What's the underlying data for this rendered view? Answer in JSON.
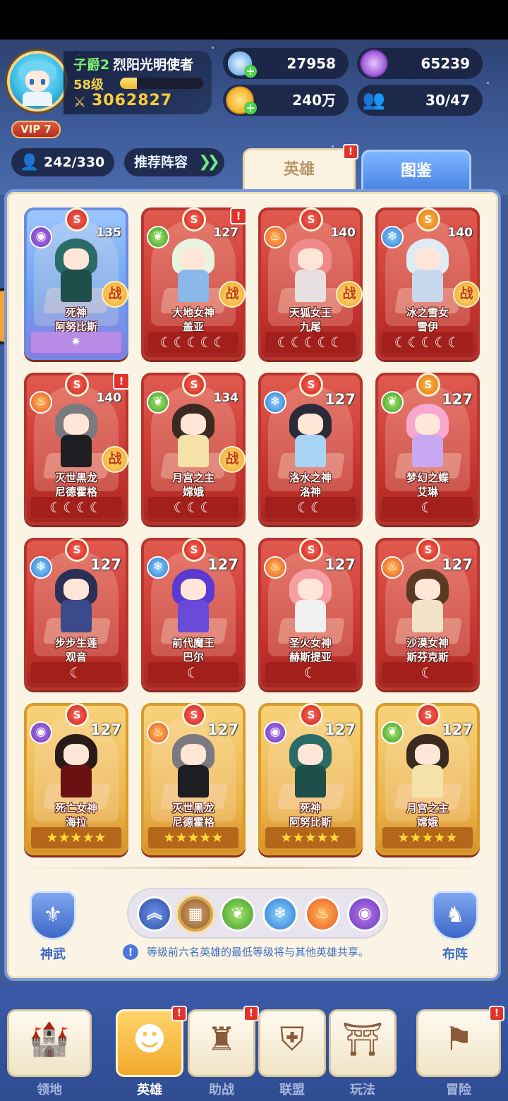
{
  "player": {
    "rank": "子爵2",
    "title": "烈阳光明使者",
    "level": "58级",
    "exp_progress": 0.2,
    "power": "3062827",
    "vip": "VIP 7"
  },
  "resources": {
    "crystals": "27958",
    "orbs": "65239",
    "gold": "240万",
    "friends": "30/47"
  },
  "hero_slots": "242/330",
  "recommend_label": "推荐阵容",
  "tabs": {
    "heroes": "英雄",
    "codex": "图鉴"
  },
  "battle_mark": "战",
  "heroes": [
    {
      "grade": "S",
      "element": "dark",
      "level": "135",
      "title": "死神",
      "name": "阿努比斯",
      "bottom": "✷",
      "style": "blue",
      "battle": true
    },
    {
      "grade": "S",
      "element": "nature",
      "level": "127",
      "title": "大地女神",
      "name": "盖亚",
      "bottom": "☾☾☾☾☾",
      "style": "red",
      "battle": true,
      "alert": true
    },
    {
      "grade": "S",
      "element": "fire",
      "level": "140",
      "title": "天狐女王",
      "name": "九尾",
      "bottom": "☾☾☾☾☾",
      "style": "red",
      "battle": true
    },
    {
      "grade": "S",
      "element": "ice",
      "level": "140",
      "title": "冰之雪女",
      "name": "雪伊",
      "bottom": "☾☾☾☾☾",
      "style": "red",
      "battle": true,
      "gold_grade": true
    },
    {
      "grade": "S",
      "element": "fire",
      "level": "140",
      "title": "灭世黑龙",
      "name": "尼德霍格",
      "bottom": "☾☾☾☾",
      "style": "red",
      "battle": true,
      "alert": true
    },
    {
      "grade": "S",
      "element": "nature",
      "level": "134",
      "title": "月宫之主",
      "name": "嫦娥",
      "bottom": "☾☾☾",
      "style": "red",
      "battle": true
    },
    {
      "grade": "S",
      "element": "ice",
      "level": "127",
      "title": "洛水之神",
      "name": "洛神",
      "bottom": "☾☾",
      "style": "red"
    },
    {
      "grade": "S",
      "element": "nature",
      "level": "127",
      "title": "梦幻之蝶",
      "name": "艾琳",
      "bottom": "☾",
      "style": "red",
      "gold_grade": true
    },
    {
      "grade": "S",
      "element": "ice",
      "level": "127",
      "title": "步步生莲",
      "name": "观音",
      "bottom": "☾",
      "style": "red"
    },
    {
      "grade": "S",
      "element": "ice",
      "level": "127",
      "title": "前代魔王",
      "name": "巴尔",
      "bottom": "☾",
      "style": "red"
    },
    {
      "grade": "S",
      "element": "fire",
      "level": "127",
      "title": "圣火女神",
      "name": "赫斯提亚",
      "bottom": "☾",
      "style": "red"
    },
    {
      "grade": "S",
      "element": "fire",
      "level": "127",
      "title": "沙漠女神",
      "name": "斯芬克斯",
      "bottom": "☾",
      "style": "red"
    },
    {
      "grade": "S",
      "element": "dark",
      "level": "127",
      "title": "死亡女神",
      "name": "海拉",
      "bottom": "★★★★★",
      "style": "gold"
    },
    {
      "grade": "S",
      "element": "fire",
      "level": "127",
      "title": "灭世黑龙",
      "name": "尼德霍格",
      "bottom": "★★★★★",
      "style": "gold"
    },
    {
      "grade": "S",
      "element": "dark",
      "level": "127",
      "title": "死神",
      "name": "阿努比斯",
      "bottom": "★★★★★",
      "style": "gold"
    },
    {
      "grade": "S",
      "element": "nature",
      "level": "127",
      "title": "月宫之主",
      "name": "嫦娥",
      "bottom": "★★★★★",
      "style": "gold"
    }
  ],
  "side_buttons": {
    "left": "神武",
    "right": "布阵"
  },
  "filters": [
    "rank",
    "all",
    "nature",
    "ice",
    "fire",
    "dark"
  ],
  "hint": "等级前六名英雄的最低等级将与其他英雄共享。",
  "nav": [
    {
      "label": "领地",
      "icon": "castle-icon"
    },
    {
      "label": "英雄",
      "icon": "hero-icon",
      "active": true,
      "alert": true
    },
    {
      "label": "助战",
      "icon": "assist-icon",
      "alert": true
    },
    {
      "label": "联盟",
      "icon": "alliance-icon"
    },
    {
      "label": "玩法",
      "icon": "gate-icon"
    },
    {
      "label": "冒险",
      "icon": "flag-icon",
      "alert": true
    }
  ],
  "alert_mark": "!"
}
